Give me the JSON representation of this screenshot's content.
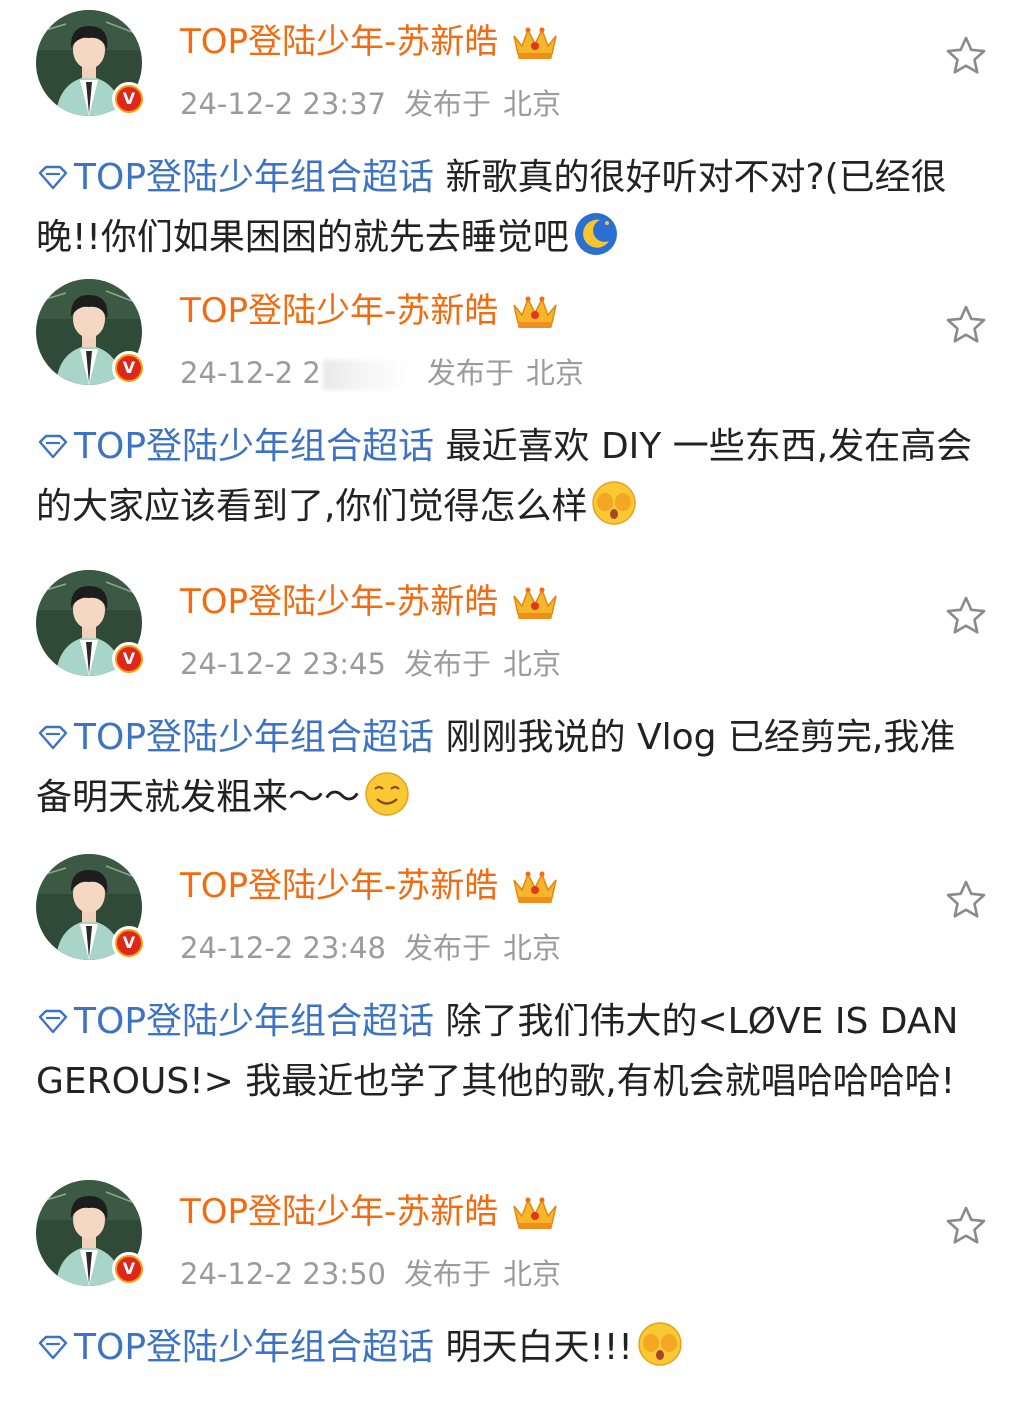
{
  "colors": {
    "username": "#f26b10",
    "meta": "#9b9b9b",
    "topic": "#3d73c4",
    "body_text": "#222222",
    "verified_badge": "#e0251b"
  },
  "posts": [
    {
      "username": "TOP登陆少年-苏新皓",
      "time": "24-12-2 23:37",
      "location_label": "发布于",
      "location": "北京",
      "topic": "TOP登陆少年组合超话",
      "text": "新歌真的很好听对不对?(已经很晚!!你们如果困困的就先去睡觉吧",
      "emoji": "moon-sleep-emoji"
    },
    {
      "username": "TOP登陆少年-苏新皓",
      "time": "24-12-2 2",
      "location_label": "发布于",
      "location": "北京",
      "topic": "TOP登陆少年组合超话",
      "text": "最近喜欢 DIY 一些东西,发在高会的大家应该看到了,你们觉得怎么样",
      "emoji": "shy-face-emoji"
    },
    {
      "username": "TOP登陆少年-苏新皓",
      "time": "24-12-2 23:45",
      "location_label": "发布于",
      "location": "北京",
      "topic": "TOP登陆少年组合超话",
      "text": "刚刚我说的 Vlog 已经剪完,我准备明天就发粗来～～",
      "emoji": "smile-face-emoji"
    },
    {
      "username": "TOP登陆少年-苏新皓",
      "time": "24-12-2 23:48",
      "location_label": "发布于",
      "location": "北京",
      "topic": "TOP登陆少年组合超话",
      "text": "除了我们伟大的<LØVE IS DANGEROUS!> 我最近也学了其他的歌,有机会就唱哈哈哈哈!",
      "emoji": ""
    },
    {
      "username": "TOP登陆少年-苏新皓",
      "time": "24-12-2 23:50",
      "location_label": "发布于",
      "location": "北京",
      "topic": "TOP登陆少年组合超话",
      "text": "明天白天!!!",
      "emoji": "shy-face-emoji"
    }
  ]
}
